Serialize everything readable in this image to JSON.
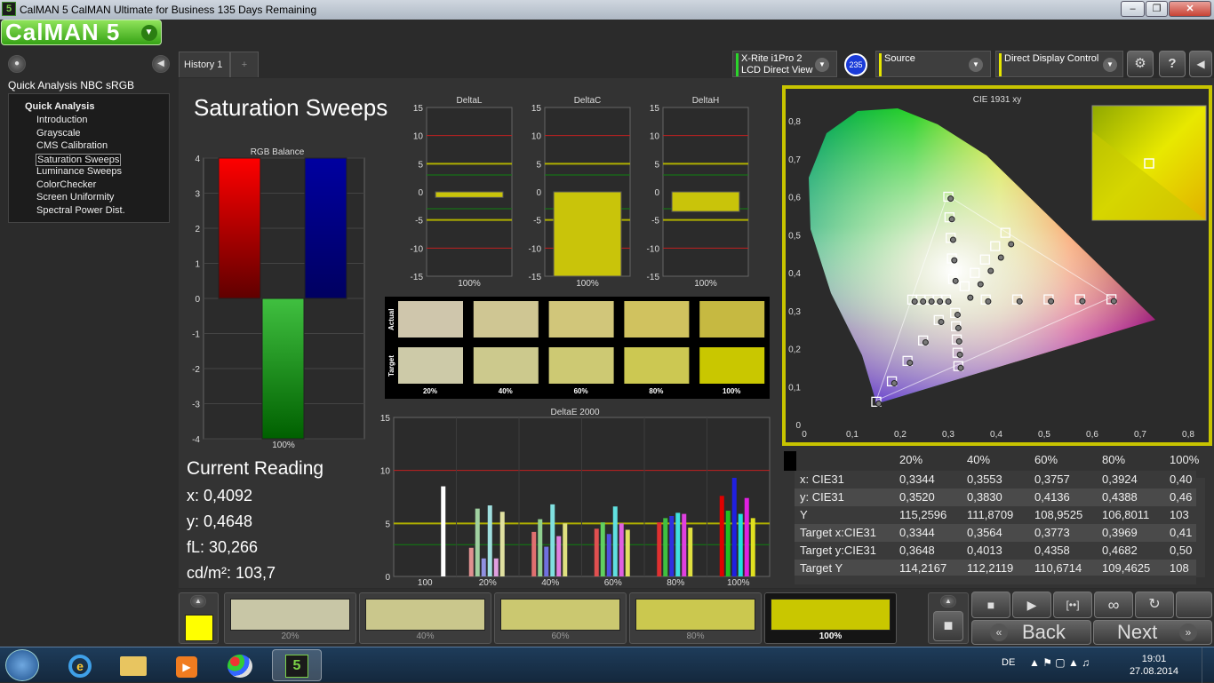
{
  "window": {
    "title": "CalMAN 5 CalMAN Ultimate for Business 135 Days Remaining",
    "app_icon": "5",
    "logo": "CalMAN 5"
  },
  "left_panel": {
    "workflow_title": "Quick Analysis NBC sRGB",
    "tree_root": "Quick Analysis",
    "items": [
      {
        "label": "Introduction",
        "selected": false
      },
      {
        "label": "Grayscale",
        "selected": false
      },
      {
        "label": "CMS Calibration",
        "selected": false
      },
      {
        "label": "Saturation Sweeps",
        "selected": true
      },
      {
        "label": "Luminance Sweeps",
        "selected": false
      },
      {
        "label": "ColorChecker",
        "selected": false
      },
      {
        "label": "Screen Uniformity",
        "selected": false
      },
      {
        "label": "Spectral Power Dist.",
        "selected": false
      }
    ]
  },
  "tabs": [
    {
      "label": "History 1"
    },
    {
      "label": "+"
    }
  ],
  "instruments": {
    "meter": {
      "line1": "X-Rite i1Pro 2",
      "line2": "LCD Direct View",
      "badge": "235",
      "color": "#2bd42b"
    },
    "source": {
      "line1": "Source",
      "color": "#e6e600"
    },
    "display": {
      "line1": "Direct Display Control",
      "color": "#e6e600"
    }
  },
  "page_title": "Saturation Sweeps",
  "rgb_balance": {
    "title": "RGB Balance",
    "yticks": [
      "4",
      "3",
      "2",
      "1",
      "0",
      "-1",
      "-2",
      "-3",
      "-4"
    ],
    "values": {
      "r": 4,
      "g": -4,
      "b": 4
    },
    "xlabel": "100%"
  },
  "delta_charts": [
    {
      "title": "DeltaL",
      "value": -1.0,
      "xlabel": "100%"
    },
    {
      "title": "DeltaC",
      "value": -15,
      "xlabel": "100%"
    },
    {
      "title": "DeltaH",
      "value": -3.5,
      "xlabel": "100%"
    }
  ],
  "delta_yticks": [
    "15",
    "10",
    "5",
    "0",
    "-5",
    "-10",
    "-15"
  ],
  "patches": {
    "actual_label": "Actual",
    "target_label": "Target",
    "columns": [
      {
        "label": "20%",
        "actual": "#cfc6ac",
        "target": "#cdcaa8"
      },
      {
        "label": "40%",
        "actual": "#cfc693",
        "target": "#ccc98d"
      },
      {
        "label": "60%",
        "actual": "#d1c67a",
        "target": "#cdc973"
      },
      {
        "label": "80%",
        "actual": "#d0c25f",
        "target": "#ccc852"
      },
      {
        "label": "100%",
        "actual": "#c6b941",
        "target": "#c9c700"
      }
    ]
  },
  "deltae": {
    "title": "DeltaE 2000",
    "yticks": [
      "15",
      "10",
      "5",
      "0"
    ],
    "groups": [
      {
        "label": "100",
        "bars": [
          8.5
        ]
      },
      {
        "label": "20%",
        "bars": [
          2.7,
          6.4,
          1.7,
          6.7,
          1.7,
          6.1
        ]
      },
      {
        "label": "40%",
        "bars": [
          4.2,
          5.4,
          2.8,
          6.8,
          3.8,
          5.0
        ]
      },
      {
        "label": "60%",
        "bars": [
          4.5,
          5.1,
          4.0,
          6.6,
          5.0,
          4.4
        ]
      },
      {
        "label": "80%",
        "bars": [
          5.1,
          5.5,
          5.7,
          6.0,
          5.9,
          4.6
        ]
      },
      {
        "label": "100%",
        "bars": [
          7.6,
          6.2,
          9.3,
          5.9,
          7.4,
          5.5
        ]
      }
    ]
  },
  "current_reading": {
    "title": "Current Reading",
    "x": "x: 0,4092",
    "y": "y: 0,4648",
    "fl": "fL: 30,266",
    "cd": "cd/m²: 103,7"
  },
  "cie": {
    "title": "CIE 1931 xy",
    "xticks": [
      "0",
      "0,1",
      "0,2",
      "0,3",
      "0,4",
      "0,5",
      "0,6",
      "0,7",
      "0,8"
    ],
    "yticks": [
      "0,8",
      "0,7",
      "0,6",
      "0,5",
      "0,4",
      "0,3",
      "0,2",
      "0,1",
      "0"
    ]
  },
  "table": {
    "columns": [
      "20%",
      "40%",
      "60%",
      "80%",
      "100%"
    ],
    "rows": [
      {
        "label": "x: CIE31",
        "values": [
          "0,3344",
          "0,3553",
          "0,3757",
          "0,3924",
          "0,40"
        ]
      },
      {
        "label": "y: CIE31",
        "values": [
          "0,3520",
          "0,3830",
          "0,4136",
          "0,4388",
          "0,46"
        ]
      },
      {
        "label": "Y",
        "values": [
          "115,2596",
          "111,8709",
          "108,9525",
          "106,8011",
          "103"
        ]
      },
      {
        "label": "Target x:CIE31",
        "values": [
          "0,3344",
          "0,3564",
          "0,3773",
          "0,3969",
          "0,41"
        ]
      },
      {
        "label": "Target y:CIE31",
        "values": [
          "0,3648",
          "0,4013",
          "0,4358",
          "0,4682",
          "0,50"
        ]
      },
      {
        "label": "Target Y",
        "values": [
          "114,2167",
          "112,2119",
          "110,6714",
          "109,4625",
          "108"
        ]
      }
    ]
  },
  "bottom_swatches": [
    {
      "label": "20%",
      "color": "#c8c6a6"
    },
    {
      "label": "40%",
      "color": "#cac78c"
    },
    {
      "label": "60%",
      "color": "#cbc870"
    },
    {
      "label": "80%",
      "color": "#cbc84f"
    },
    {
      "label": "100%",
      "color": "#c9c700",
      "active": true
    }
  ],
  "current_swatch_color": "#ffff00",
  "nav": {
    "back": "Back",
    "next": "Next"
  },
  "taskbar": {
    "lang": "DE",
    "time": "19:01",
    "date": "27.08.2014"
  }
}
